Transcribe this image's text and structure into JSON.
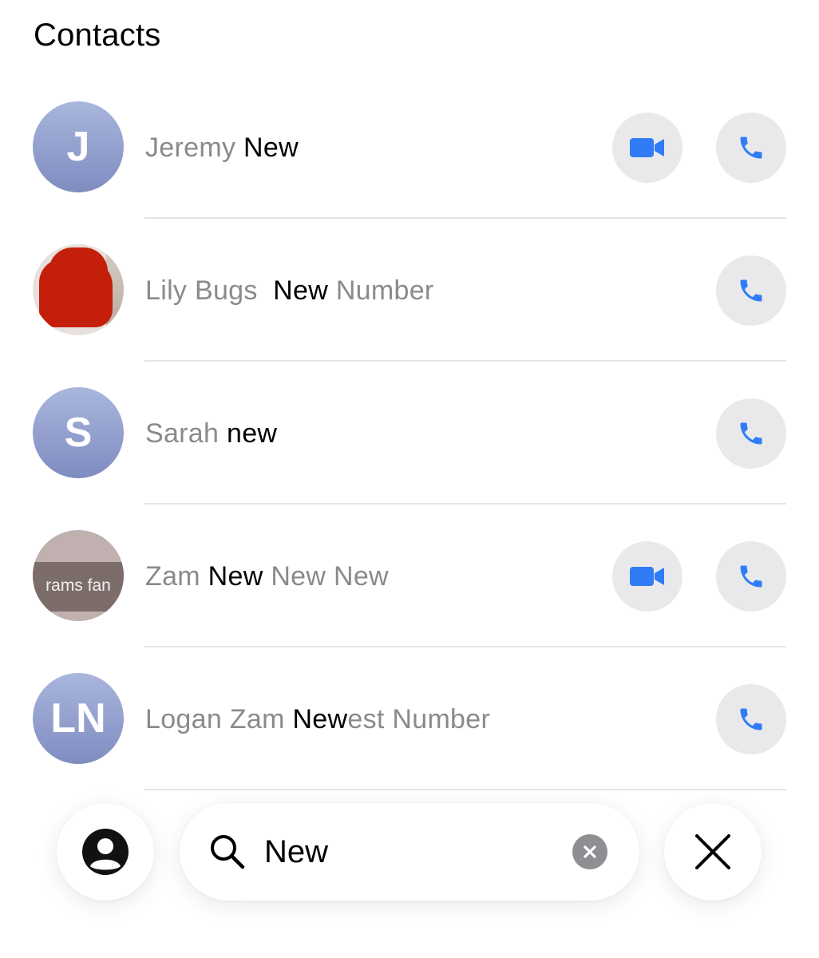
{
  "section": {
    "title": "Contacts"
  },
  "contacts": [
    {
      "name_parts": [
        {
          "text": "Jeremy ",
          "highlight": false
        },
        {
          "text": "New",
          "highlight": true
        }
      ],
      "avatar": {
        "type": "initials",
        "initials": "J"
      },
      "actions": [
        "video",
        "call"
      ]
    },
    {
      "name_parts": [
        {
          "text": "Lily Bugs  ",
          "highlight": false
        },
        {
          "text": "New",
          "highlight": true
        },
        {
          "text": " Number",
          "highlight": false
        }
      ],
      "avatar": {
        "type": "photo",
        "description_icon": "red-photo"
      },
      "actions": [
        "call"
      ]
    },
    {
      "name_parts": [
        {
          "text": "Sarah ",
          "highlight": false
        },
        {
          "text": "new",
          "highlight": true
        }
      ],
      "avatar": {
        "type": "initials",
        "initials": "S"
      },
      "actions": [
        "call"
      ]
    },
    {
      "name_parts": [
        {
          "text": "Zam ",
          "highlight": false
        },
        {
          "text": "New",
          "highlight": true
        },
        {
          "text": " New New",
          "highlight": false
        }
      ],
      "avatar": {
        "type": "photo",
        "photo_text": "rams fan"
      },
      "actions": [
        "video",
        "call"
      ]
    },
    {
      "name_parts": [
        {
          "text": "Logan Zam ",
          "highlight": false
        },
        {
          "text": "New",
          "highlight": true
        },
        {
          "text": "est Number",
          "highlight": false
        }
      ],
      "avatar": {
        "type": "initials",
        "initials": "LN"
      },
      "actions": [
        "call"
      ]
    }
  ],
  "search": {
    "value": "New",
    "placeholder": "Search"
  },
  "icons": {
    "profile": "person-circle-icon",
    "search": "magnifying-glass-icon",
    "clear": "clear-circle-icon",
    "close": "close-x-icon",
    "video": "video-camera-icon",
    "call": "phone-icon"
  },
  "colors": {
    "accent": "#2f7cf6",
    "highlight_text": "#000000",
    "dim_text": "#8a8a8e",
    "action_bg": "#e9e9ec",
    "avatar_gradient_top": "#a9b6dd",
    "avatar_gradient_bottom": "#7f8cc0"
  }
}
